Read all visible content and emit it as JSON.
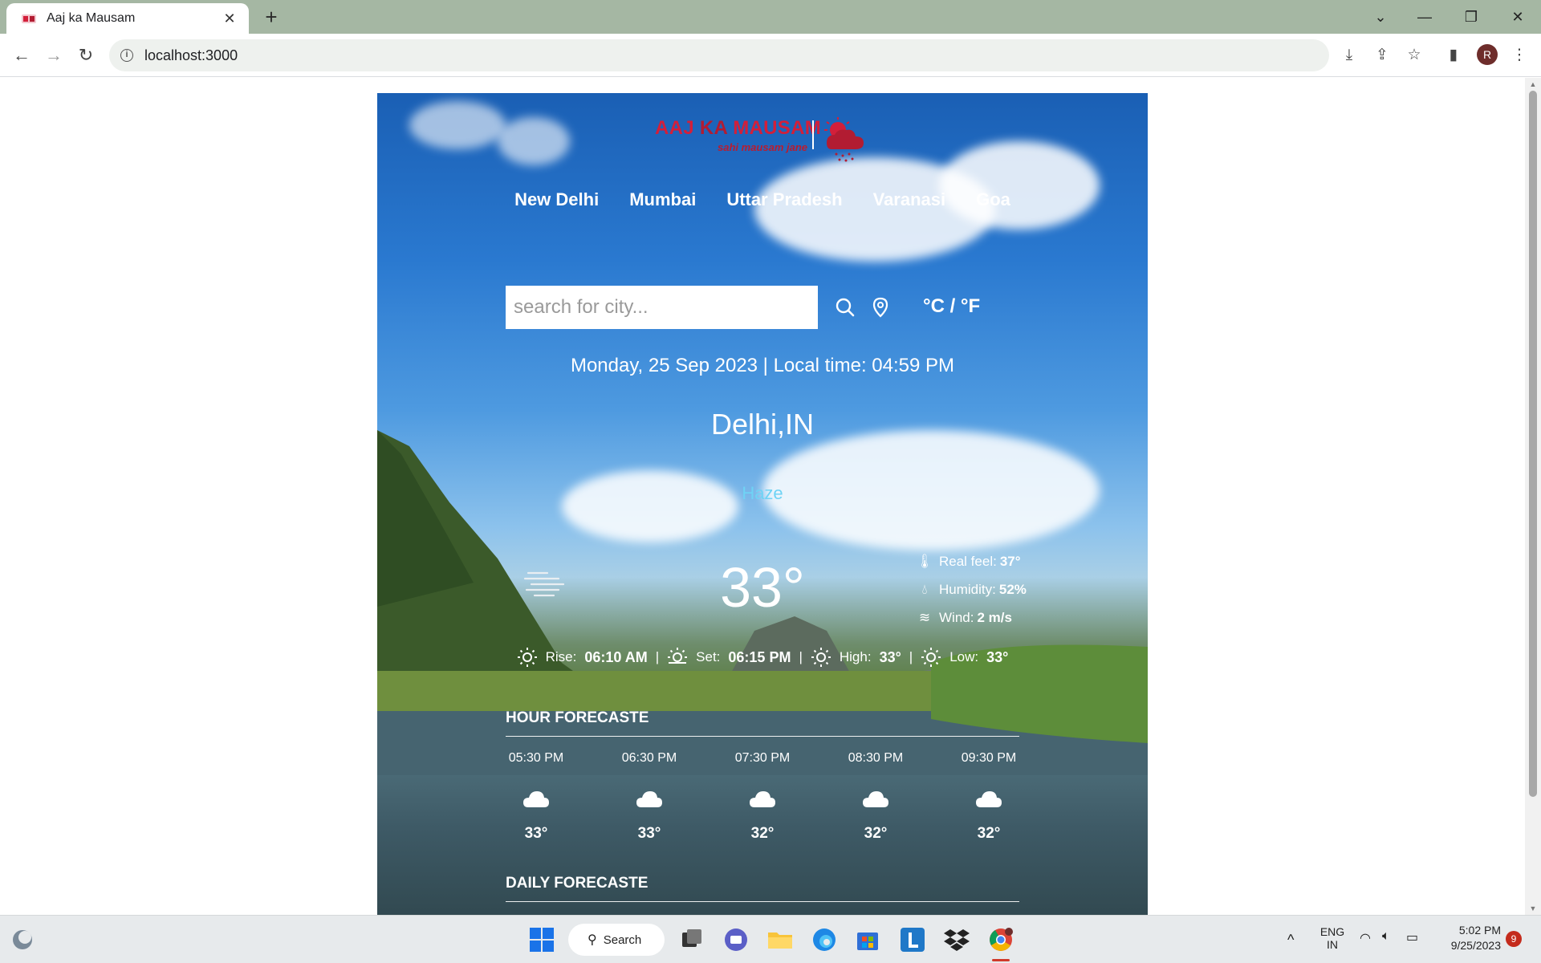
{
  "browser": {
    "tab_title": "Aaj ka Mausam",
    "tab_close": "✕",
    "new_tab": "+",
    "url": "localhost:3000",
    "avatar_letter": "R"
  },
  "app": {
    "logo": {
      "part1": "AAJ ",
      "part2": "KA",
      "part3": " MAUSAM",
      "tagline": "sahi mausam jane"
    },
    "cities": [
      "New Delhi",
      "Mumbai",
      "Uttar Pradesh",
      "Varanasi",
      "Goa"
    ],
    "search": {
      "placeholder": "search for city..."
    },
    "unit_toggle": "°C / °F",
    "datetime": "Monday, 25 Sep 2023 | Local time: 04:59 PM",
    "location": "Delhi,IN",
    "condition": "Haze",
    "temperature": "33°",
    "details": {
      "real_feel_label": "Real feel:",
      "real_feel": "37°",
      "humidity_label": "Humidity:",
      "humidity": "52%",
      "wind_label": "Wind:",
      "wind": "2 m/s"
    },
    "sun": {
      "rise_label": "Rise:",
      "rise": "06:10 AM",
      "set_label": "Set:",
      "set": "06:15 PM",
      "high_label": "High:",
      "high": "33°",
      "low_label": "Low:",
      "low": "33°",
      "separator": "|"
    },
    "hourly_title": "HOUR FORECASTE",
    "hourly": [
      {
        "time": "05:30 PM",
        "temp": "33°"
      },
      {
        "time": "06:30 PM",
        "temp": "33°"
      },
      {
        "time": "07:30 PM",
        "temp": "32°"
      },
      {
        "time": "08:30 PM",
        "temp": "32°"
      },
      {
        "time": "09:30 PM",
        "temp": "32°"
      }
    ],
    "daily_title": "DAILY FORECASTE"
  },
  "taskbar": {
    "search_label": "Search",
    "lang_top": "ENG",
    "lang_bottom": "IN",
    "time": "5:02 PM",
    "date": "9/25/2023",
    "notifications": "9"
  },
  "colors": {
    "brand_red": "#d31f3a",
    "condition_cyan": "#6fd3f5"
  }
}
